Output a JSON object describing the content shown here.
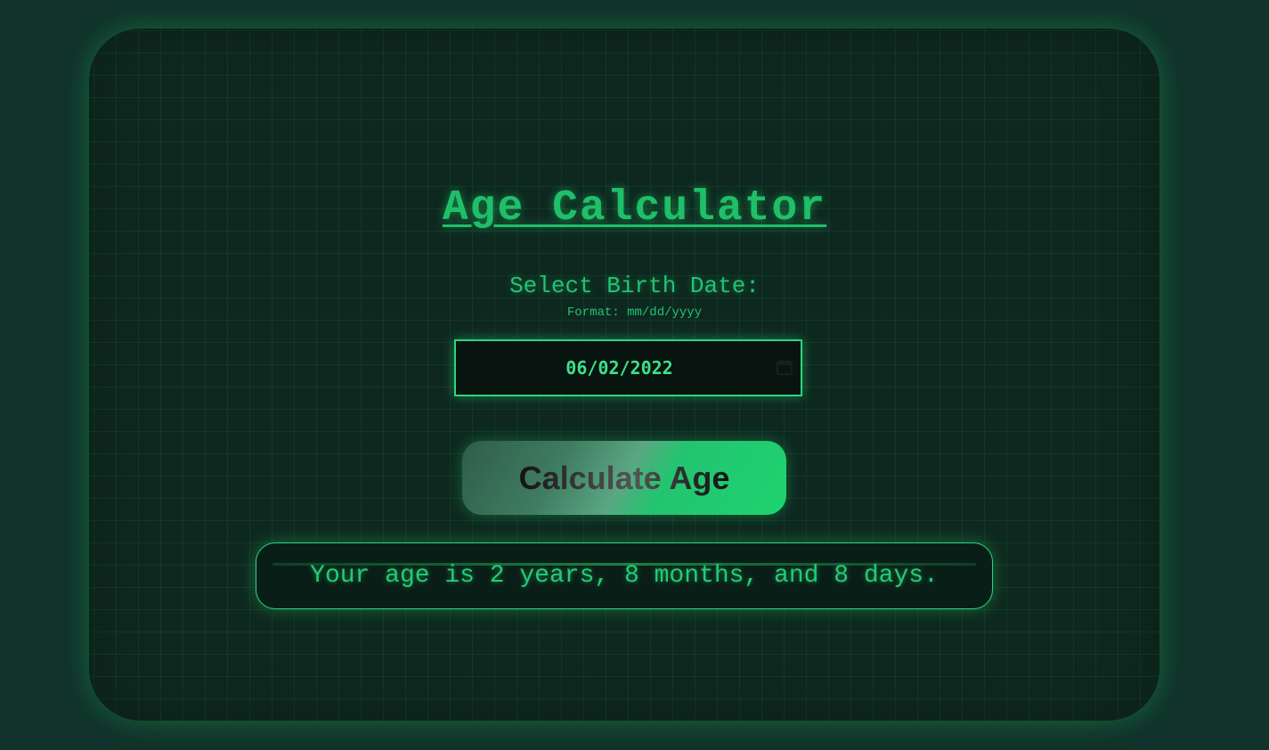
{
  "app": {
    "title": "Age Calculator"
  },
  "form": {
    "label": "Select Birth Date:",
    "format_hint": "Format: mm/dd/yyyy",
    "date_value": "06/02/2022",
    "calendar_icon": "calendar-icon"
  },
  "actions": {
    "calculate_label": "Calculate Age"
  },
  "result": {
    "text": "Your age is 2 years, 8 months, and 8 days."
  },
  "colors": {
    "background": "#11332b",
    "panel": "#0e2820",
    "accent": "#22c55e",
    "text": "#22c474"
  }
}
